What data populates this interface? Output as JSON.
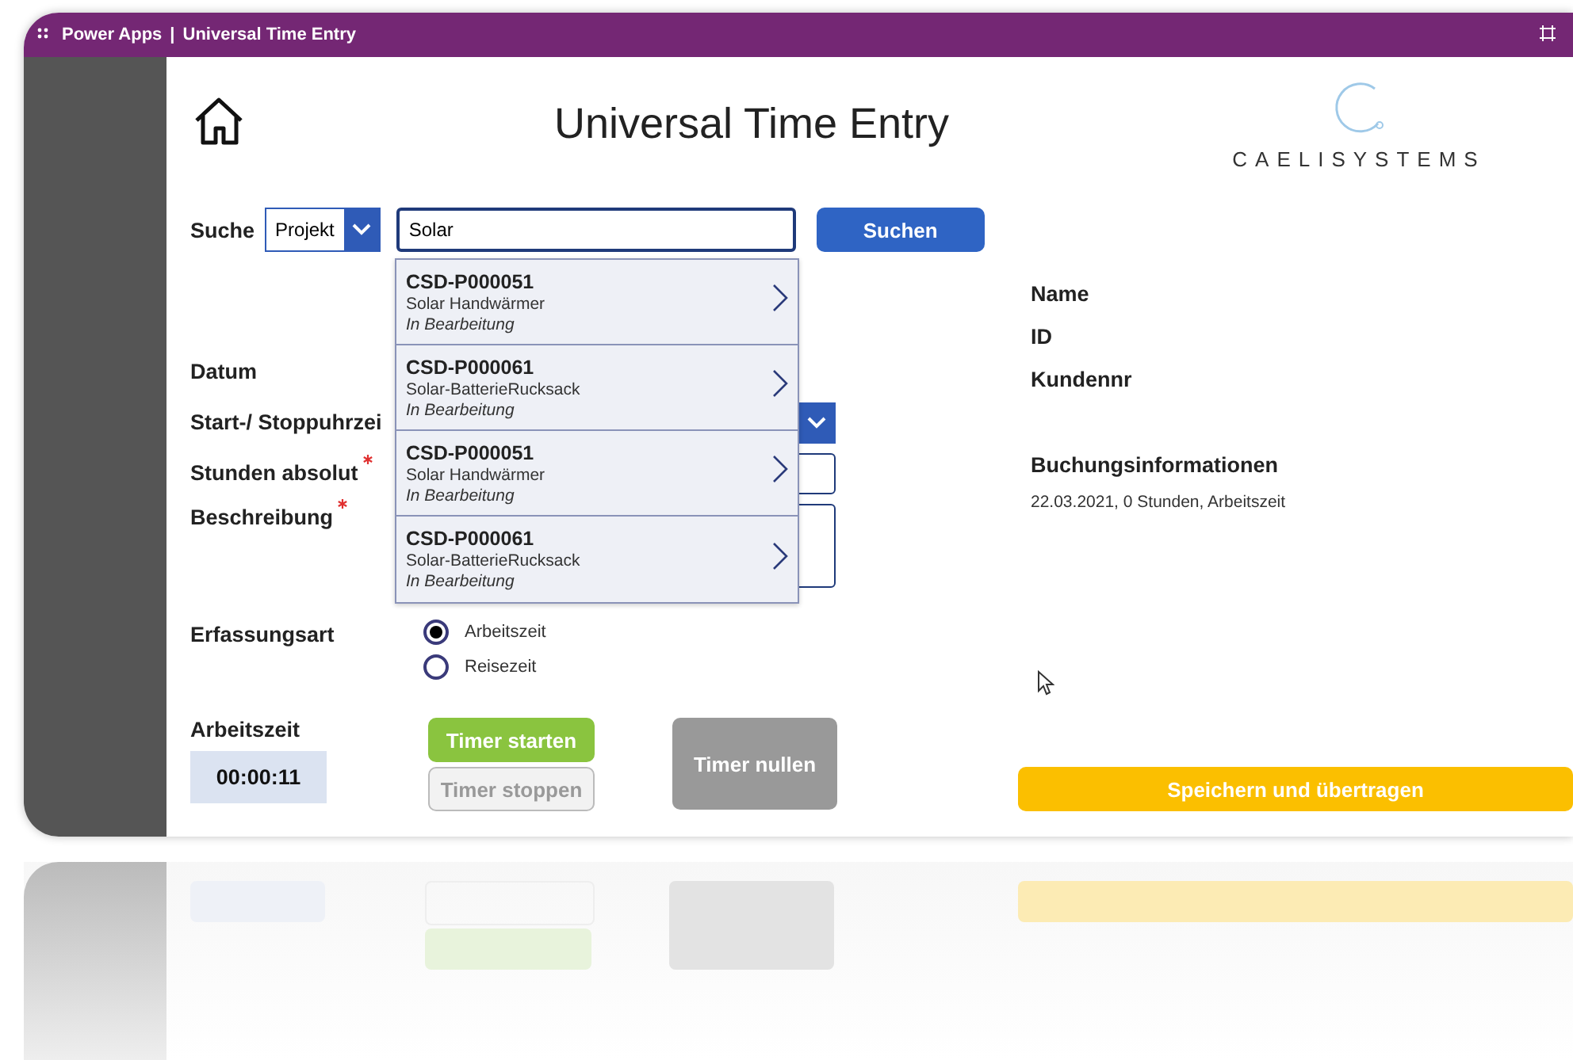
{
  "title_bar": {
    "app": "Power Apps",
    "separator": "|",
    "title": "Universal Time Entry"
  },
  "header": {
    "title": "Universal Time Entry",
    "logo_text": "CAELISYSTEMS"
  },
  "search": {
    "label": "Suche",
    "type_dropdown": "Projekt",
    "query": "Solar",
    "button": "Suchen"
  },
  "results": [
    {
      "code": "CSD-P000051",
      "name": "Solar Handwärmer",
      "status": "In Bearbeitung"
    },
    {
      "code": "CSD-P000061",
      "name": "Solar-BatterieRucksack",
      "status": "In Bearbeitung"
    },
    {
      "code": "CSD-P000051",
      "name": "Solar Handwärmer",
      "status": "In Bearbeitung"
    },
    {
      "code": "CSD-P000061",
      "name": "Solar-BatterieRucksack",
      "status": "In Bearbeitung"
    }
  ],
  "form_fields": [
    {
      "label": "Datum",
      "kind": "plain",
      "required": false
    },
    {
      "label": "Start-/ Stoppuhrzei",
      "kind": "dropdown",
      "required": false
    },
    {
      "label": "Stunden absolut",
      "kind": "input",
      "required": true
    },
    {
      "label": "Beschreibung",
      "kind": "textarea",
      "required": true
    }
  ],
  "capture_type": {
    "label": "Erfassungsart",
    "options": [
      {
        "label": "Arbeitszeit",
        "selected": true
      },
      {
        "label": "Reisezeit",
        "selected": false
      }
    ]
  },
  "timer": {
    "label": "Arbeitszeit",
    "value": "00:00:11",
    "buttons": [
      {
        "label": "Timer starten",
        "kind": "start",
        "disabled": false
      },
      {
        "label": "Timer stoppen",
        "kind": "stop",
        "disabled": true
      },
      {
        "label": "Timer nullen",
        "kind": "reset",
        "disabled": false
      }
    ]
  },
  "details": {
    "fields": [
      "Name",
      "ID",
      "Kundennr"
    ],
    "booking_title": "Buchungsinformationen",
    "booking_text": "22.03.2021, 0 Stunden, Arbeitszeit"
  },
  "save_button": "Speichern und übertragen"
}
